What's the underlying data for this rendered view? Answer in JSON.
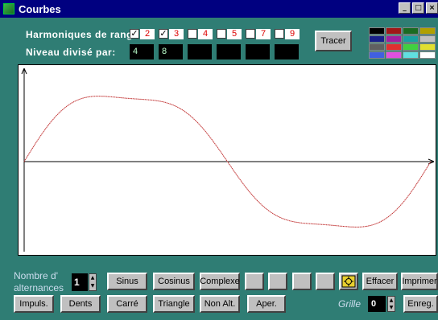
{
  "window": {
    "title": "Courbes",
    "controls": [
      "_",
      "□",
      "×"
    ]
  },
  "harmonics": {
    "label": "Harmoniques de rang:",
    "items": [
      {
        "value": "2",
        "checked": true
      },
      {
        "value": "3",
        "checked": true
      },
      {
        "value": "4",
        "checked": false
      },
      {
        "value": "5",
        "checked": false
      },
      {
        "value": "7",
        "checked": false
      },
      {
        "value": "9",
        "checked": false
      }
    ]
  },
  "levels": {
    "label": "Niveau divisé par:",
    "values": [
      "4",
      "8",
      "",
      "",
      "",
      ""
    ]
  },
  "tracer_label": "Tracer",
  "palette": {
    "colors": [
      "#000000",
      "#a01818",
      "#1a6b22",
      "#b0a000",
      "#18208a",
      "#a020a0",
      "#18a0a0",
      "#c0c0c0",
      "#606060",
      "#e03030",
      "#40d040",
      "#e0e030",
      "#4060e0",
      "#e050e0",
      "#60e0e0",
      "#ffffff"
    ]
  },
  "plot": {
    "axes_color": "#000000",
    "curve_color": "#c03030"
  },
  "controls": {
    "nombre_label_1": "Nombre d'",
    "nombre_label_2": "alternances",
    "nombre_value": "1",
    "row1": [
      "Sinus",
      "Cosinus",
      "Complexe",
      "",
      "",
      "",
      ""
    ],
    "row2": [
      "Impuls.",
      "Dents",
      "Carré",
      "Triangle",
      "Non Alt.",
      "Aper."
    ],
    "effacer": "Effacer",
    "imprimer": "Imprimer",
    "enreg": "Enreg.",
    "grille_label": "Grille",
    "grille_value": "0"
  }
}
